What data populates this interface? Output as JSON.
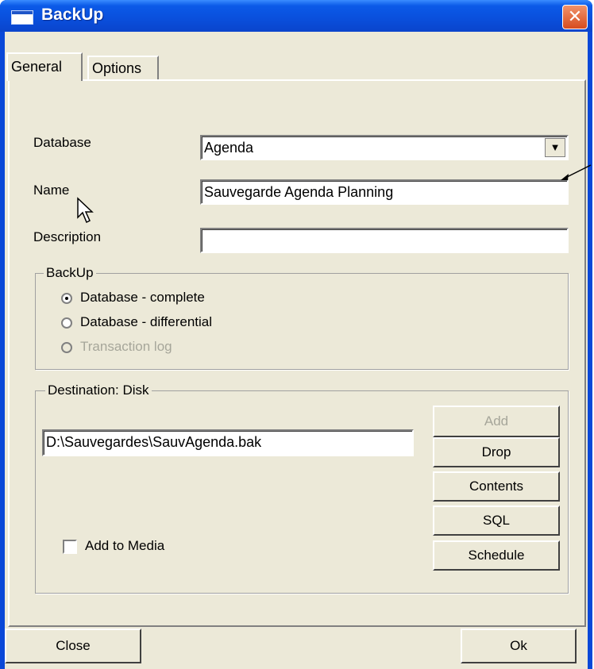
{
  "window": {
    "title": "BackUp",
    "close_glyph": "✕"
  },
  "tabs": [
    "General",
    "Options"
  ],
  "fields": {
    "database_label": "Database",
    "database_value": "Agenda",
    "name_label": "Name",
    "name_value": "Sauvegarde Agenda Planning",
    "description_label": "Description",
    "description_value": ""
  },
  "backup_group": {
    "title": "BackUp",
    "options": [
      {
        "label": "Database - complete",
        "checked": true,
        "enabled": true
      },
      {
        "label": "Database - differential",
        "checked": false,
        "enabled": true
      },
      {
        "label": "Transaction log",
        "checked": false,
        "enabled": false
      }
    ]
  },
  "destination_group": {
    "title": "Destination: Disk",
    "path": "D:\\Sauvegardes\\SauvAgenda.bak",
    "add_to_media_label": "Add to Media",
    "buttons": [
      "Add",
      "Drop",
      "Contents",
      "SQL",
      "Schedule"
    ]
  },
  "footer": {
    "close_label": "Close",
    "ok_label": "Ok"
  },
  "icons": [
    "window-icon",
    "close-icon",
    "dropdown-arrow-icon",
    "mouse-cursor-icon",
    "annotation-arrow-icon"
  ]
}
